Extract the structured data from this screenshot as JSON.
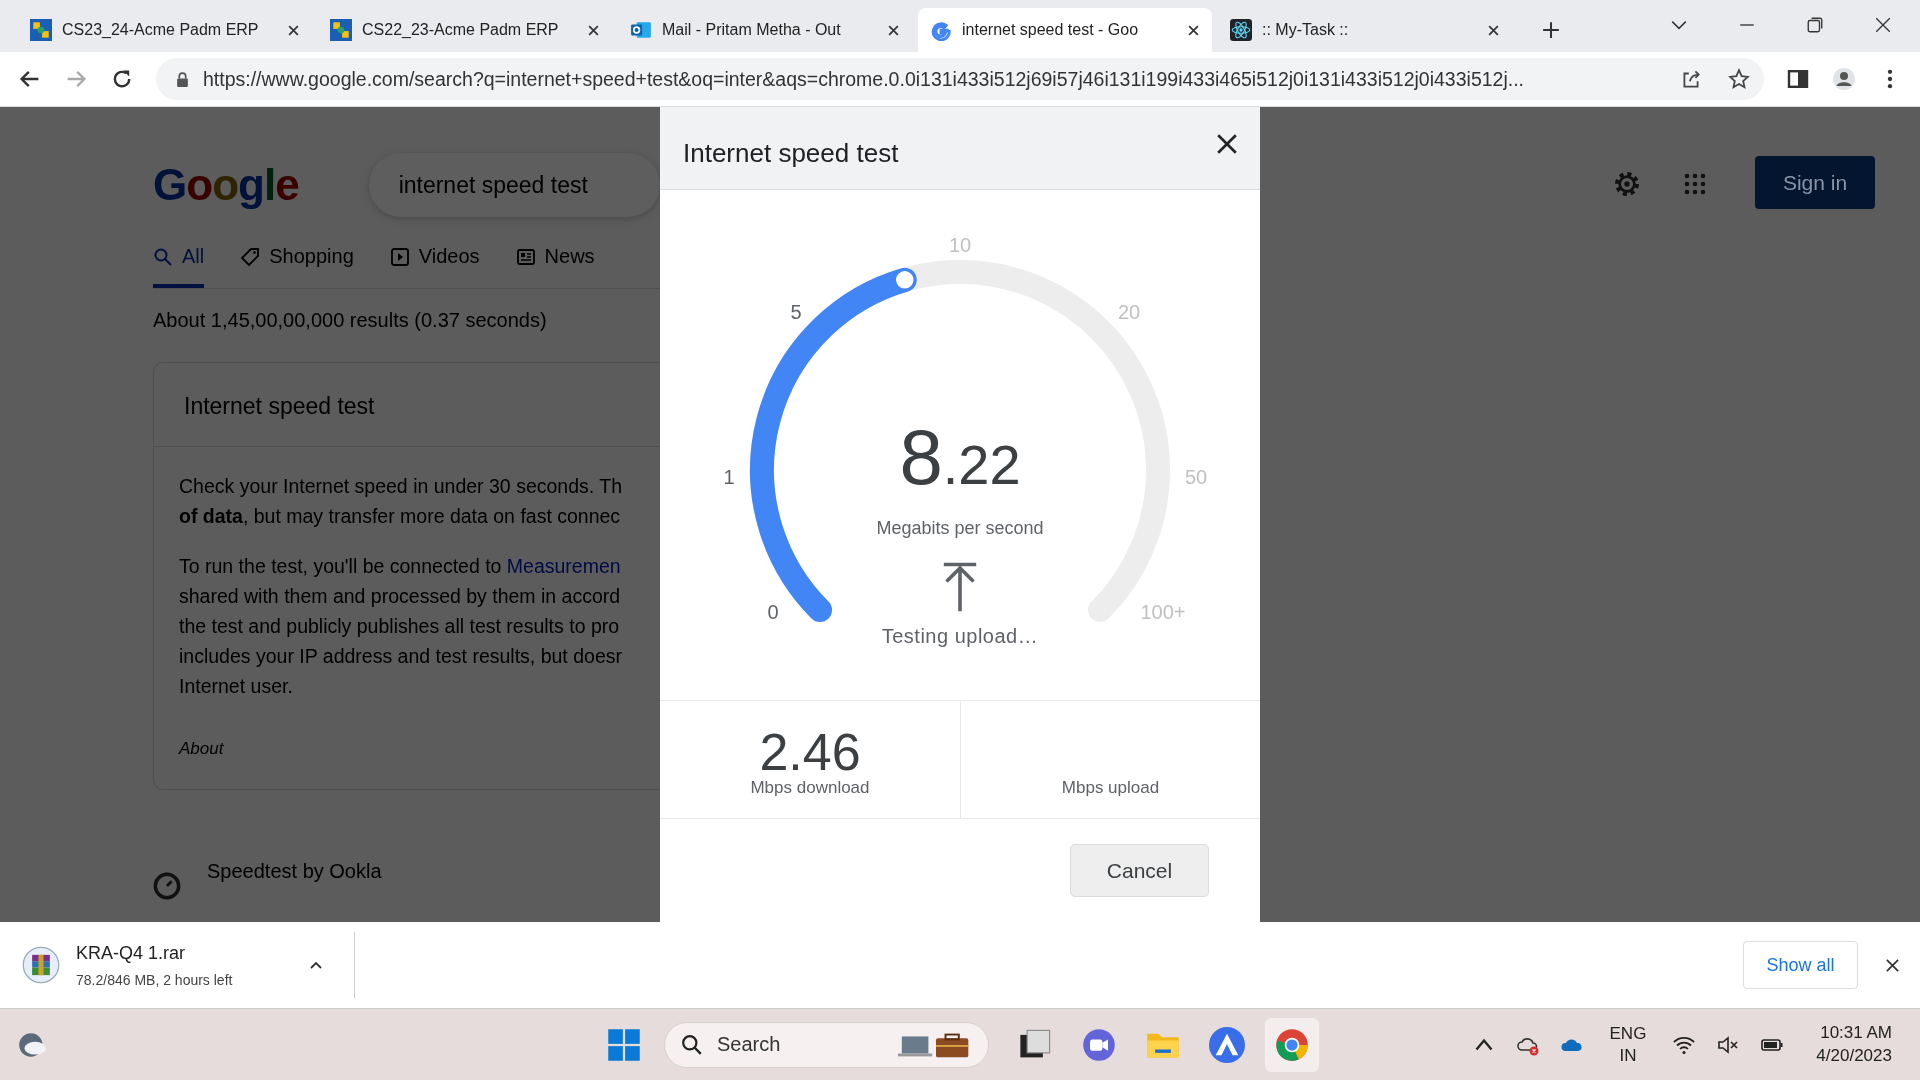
{
  "browser": {
    "tabs": [
      {
        "title": "CS23_24-Acme Padm ERP",
        "kind": "erp",
        "selected": false
      },
      {
        "title": "CS22_23-Acme Padm ERP",
        "kind": "erp",
        "selected": false
      },
      {
        "title": "Mail - Pritam Metha - Out",
        "kind": "mail",
        "selected": false
      },
      {
        "title": "internet speed test - Goo",
        "kind": "google",
        "selected": true
      },
      {
        "title": ":: My-Task ::",
        "kind": "atom",
        "selected": false
      }
    ],
    "url": "https://www.google.com/search?q=internet+speed+test&oq=inter&aqs=chrome.0.0i131i433i512j69i57j46i131i199i433i465i512j0i131i433i512j0i433i512j..."
  },
  "page": {
    "logo": "Google",
    "query": "internet speed test",
    "nav": [
      {
        "label": "All",
        "kind": "search",
        "selected": true
      },
      {
        "label": "Shopping",
        "kind": "tag",
        "selected": false
      },
      {
        "label": "Videos",
        "kind": "play",
        "selected": false
      },
      {
        "label": "News",
        "kind": "news",
        "selected": false
      }
    ],
    "result_stats": "About 1,45,00,00,000 results (0.37 seconds)",
    "card": {
      "title": "Internet speed test",
      "paragraphs": [
        [
          {
            "text": "Check your Internet speed in under 30 seconds. Th"
          },
          {
            "text": "**of data**, but may transfer more data on fast connec"
          }
        ],
        [
          {
            "text": "To run the test, you'll be connected to ",
            "link": "Measuremen"
          },
          {
            "text": "shared with them and processed by them in accord"
          },
          {
            "text": "the test and publicly publishes all test results to pro"
          },
          {
            "text": "includes your IP address and test results, but doesr"
          },
          {
            "text": "Internet user."
          }
        ]
      ],
      "about": "About"
    },
    "next_result": "Speedtest by Ookla",
    "sign_in": "Sign in"
  },
  "dialog": {
    "title": "Internet speed test",
    "ticks": [
      {
        "label": "0",
        "reached": true
      },
      {
        "label": "1",
        "reached": true
      },
      {
        "label": "5",
        "reached": true
      },
      {
        "label": "10",
        "reached": false
      },
      {
        "label": "20",
        "reached": false
      },
      {
        "label": "50",
        "reached": false
      },
      {
        "label": "100+",
        "reached": false
      }
    ],
    "level": 0.44,
    "speed_whole": "8",
    "speed_fraction": ".22",
    "unit": "Megabits per second",
    "status": "Testing upload…",
    "stats": [
      {
        "value": "2.46",
        "label": "Mbps download"
      },
      {
        "label": "Mbps upload"
      }
    ],
    "cancel": "Cancel"
  },
  "download": {
    "file": "KRA-Q4 1.rar",
    "progress": "78.2/846 MB, 2 hours left",
    "show_all": "Show all"
  },
  "taskbar": {
    "search": "Search",
    "language": "ENG",
    "region": "IN",
    "time": "10:31 AM",
    "date": "4/20/2023"
  }
}
